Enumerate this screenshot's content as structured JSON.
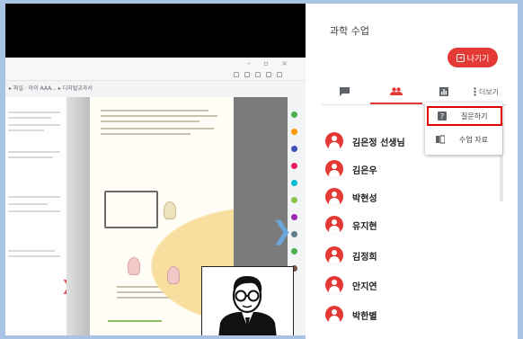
{
  "panel": {
    "title": "과학 수업",
    "leave_label": "나기기",
    "tabs": {
      "more_label": "더보기"
    },
    "participants": [
      "김은정 선생님",
      "김은우",
      "박현성",
      "유지현",
      "김정희",
      "안지연",
      "박한별"
    ],
    "menu": {
      "items": [
        "질문하기",
        "수업 자료"
      ]
    }
  },
  "share": {
    "bookmarks_text": "▸ 파일 · 아이 AAA...  ▸ 디지털교과서"
  },
  "colors": {
    "accent": "#e53935",
    "highlight_border": "#e00000",
    "frame": "#a9c3e6"
  },
  "icons": [
    "chat-icon",
    "people-icon",
    "stats-icon",
    "more-vert-icon",
    "question-icon",
    "book-icon",
    "exit-icon",
    "chevron-right-icon"
  ]
}
